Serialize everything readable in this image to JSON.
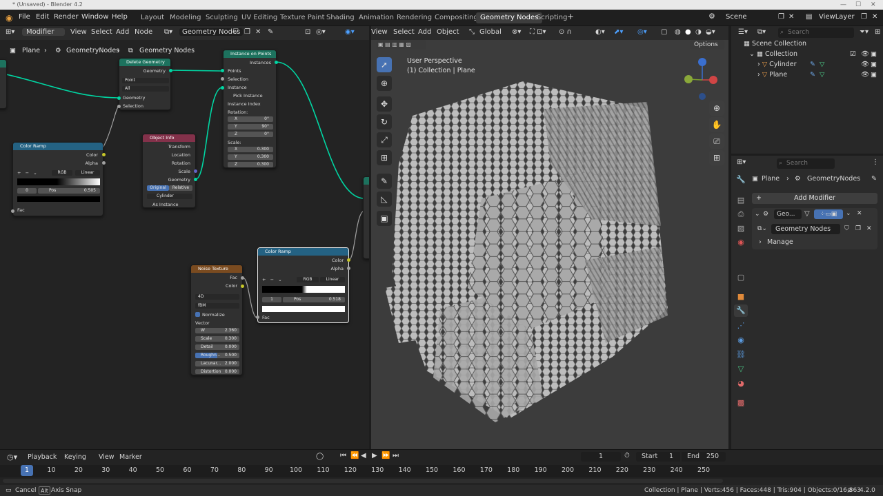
{
  "window": {
    "title": "* (Unsaved) - Blender 4.2"
  },
  "menu": [
    "File",
    "Edit",
    "Render",
    "Window",
    "Help"
  ],
  "workspaces": [
    "Layout",
    "Modeling",
    "Sculpting",
    "UV Editing",
    "Texture Paint",
    "Shading",
    "Animation",
    "Rendering",
    "Compositing",
    "Geometry Nodes",
    "Scripting"
  ],
  "active_workspace": "Geometry Nodes",
  "scene": {
    "name": "Scene",
    "view_layer": "ViewLayer"
  },
  "node_editor": {
    "mode": "Modifier",
    "menus": [
      "View",
      "Select",
      "Add",
      "Node"
    ],
    "tree_name": "Geometry Nodes",
    "breadcrumb": [
      "Plane",
      "GeometryNodes",
      "Geometry Nodes"
    ],
    "nodes": {
      "delete_geometry": {
        "title": "Delete Geometry",
        "output": "Geometry",
        "domain": "Point",
        "mode": "All",
        "inputs": [
          "Geometry",
          "Selection"
        ]
      },
      "instance_on_points": {
        "title": "Instance on Points",
        "output": "Instances",
        "inputs": [
          "Points",
          "Selection",
          "Instance",
          "Pick Instance",
          "Instance Index",
          "Rotation:"
        ],
        "rotation": [
          {
            "axis": "X",
            "value": "0°"
          },
          {
            "axis": "Y",
            "value": "90°"
          },
          {
            "axis": "Z",
            "value": "0°"
          }
        ],
        "scale_label": "Scale:",
        "scale": [
          {
            "axis": "X",
            "value": "0.300"
          },
          {
            "axis": "Y",
            "value": "0.300"
          },
          {
            "axis": "Z",
            "value": "0.300"
          }
        ]
      },
      "color_ramp_1": {
        "title": "Color Ramp",
        "outputs": [
          "Color",
          "Alpha"
        ],
        "mode": "RGB",
        "interp": "Linear",
        "index": "0",
        "pos_label": "Pos",
        "pos": "0.505",
        "input": "Fac"
      },
      "object_info": {
        "title": "Object Info",
        "outputs": [
          "Transform",
          "Location",
          "Rotation",
          "Scale",
          "Geometry"
        ],
        "toggle": [
          "Original",
          "Relative"
        ],
        "object": "Cylinder",
        "as_instance": "As Instance"
      },
      "noise_texture": {
        "title": "Noise Texture",
        "outputs": [
          "Fac",
          "Color"
        ],
        "dims": "4D",
        "type": "fBM",
        "normalize": "Normalize",
        "vector": "Vector",
        "fields": [
          {
            "label": "W",
            "value": "2.360"
          },
          {
            "label": "Scale",
            "value": "0.300"
          },
          {
            "label": "Detail",
            "value": "0.000"
          },
          {
            "label": "Roughn...",
            "value": "0.500"
          },
          {
            "label": "Lacunar...",
            "value": "2.000"
          },
          {
            "label": "Distortion",
            "value": "0.000"
          }
        ]
      },
      "color_ramp_2": {
        "title": "Color Ramp",
        "outputs": [
          "Color",
          "Alpha"
        ],
        "mode": "RGB",
        "interp": "Linear",
        "index": "1",
        "pos_label": "Pos",
        "pos": "0.518",
        "input": "Fac"
      }
    }
  },
  "viewport": {
    "menus": [
      "View",
      "Select",
      "Add",
      "Object"
    ],
    "orientation": "Global",
    "options": "Options",
    "perspective": "User Perspective",
    "collection_text": "(1) Collection | Plane"
  },
  "outliner": {
    "search_placeholder": "Search",
    "root": "Scene Collection",
    "collection": "Collection",
    "objects": [
      "Cylinder",
      "Plane"
    ]
  },
  "properties": {
    "search_placeholder": "Search",
    "object": "Plane",
    "modifier_tree": "GeometryNodes",
    "add_modifier": "Add Modifier",
    "modifier_name": "Geo...",
    "node_group": "Geometry Nodes",
    "manage": "Manage"
  },
  "timeline": {
    "menus": [
      "Playback",
      "Keying",
      "View",
      "Marker"
    ],
    "current_frame": "1",
    "start_label": "Start",
    "start": "1",
    "end_label": "End",
    "end": "250",
    "ticks": [
      "1",
      "10",
      "20",
      "30",
      "40",
      "50",
      "60",
      "70",
      "80",
      "90",
      "100",
      "110",
      "120",
      "130",
      "140",
      "150",
      "160",
      "170",
      "180",
      "190",
      "200",
      "210",
      "220",
      "230",
      "240",
      "250"
    ]
  },
  "status": {
    "left": [
      "Cancel",
      "Alt",
      "Axis Snap"
    ],
    "right": "Collection | Plane | Verts:456 | Faces:448 | Tris:904 | Objects:0/16,863",
    "version": "4.2.0"
  },
  "colors": {
    "accent": "#4772b3",
    "geometry_socket": "#00d6a3",
    "float_socket": "#a1a1a1",
    "color_socket": "#c7c729"
  }
}
